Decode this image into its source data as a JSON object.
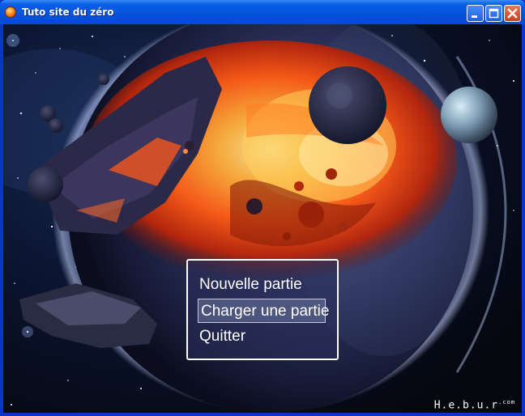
{
  "window": {
    "title": "Tuto site du zéro"
  },
  "controls": {
    "minimize": "minimize-icon",
    "maximize": "maximize-icon",
    "close": "close-icon"
  },
  "menu": {
    "items": [
      {
        "label": "Nouvelle partie",
        "selected": false
      },
      {
        "label": "Charger une partie",
        "selected": true
      },
      {
        "label": "Quitter",
        "selected": false
      }
    ]
  },
  "watermark": {
    "text": "H.e.b.u.r",
    "suffix": ".com"
  },
  "colors": {
    "titlebar": "#0553dc",
    "menu_border": "#ffffff",
    "menu_text": "#ffffff",
    "close_button": "#c8401c"
  }
}
